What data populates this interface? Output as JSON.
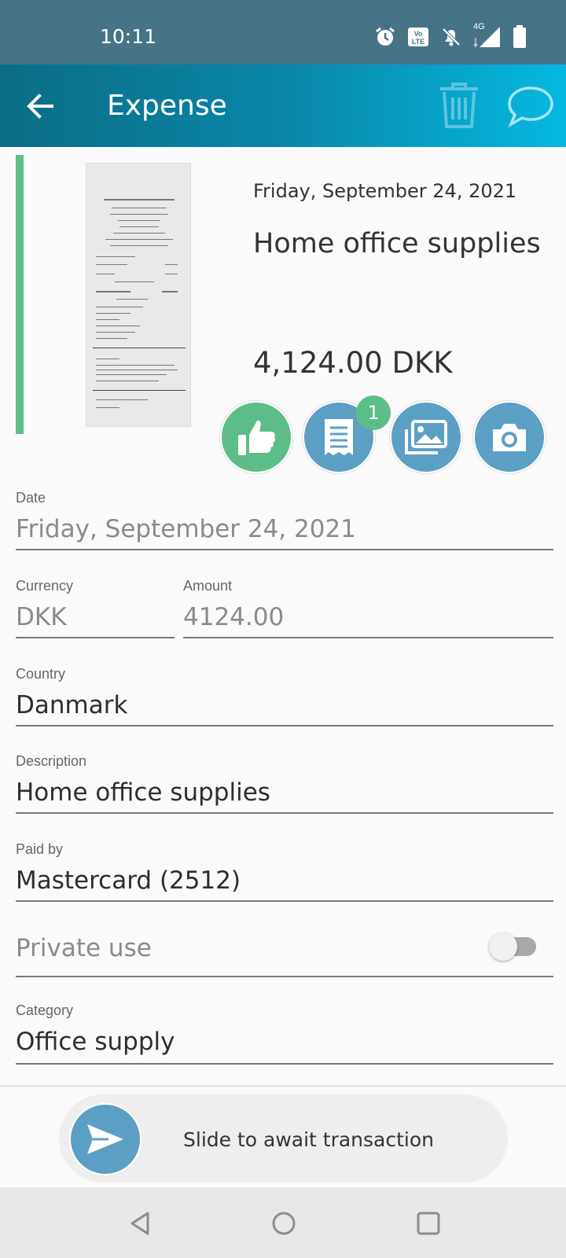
{
  "status_bar": {
    "time": "10:11",
    "network": "4G",
    "icons": [
      "alarm-icon",
      "volte-icon",
      "bell-off-icon",
      "signal-icon",
      "battery-icon"
    ]
  },
  "app_bar": {
    "title": "Expense",
    "icons": [
      "back-arrow-icon",
      "trash-icon",
      "chat-bubble-icon"
    ]
  },
  "summary": {
    "date": "Friday, September 24, 2021",
    "description": "Home office supplies",
    "amount": "4,124.00 DKK",
    "status_color": "#5fbf87",
    "receipt_badge": "1",
    "actions": [
      "thumbs-up-icon",
      "receipt-icon",
      "gallery-icon",
      "camera-icon"
    ]
  },
  "form": {
    "date": {
      "label": "Date",
      "value": "Friday, September 24, 2021"
    },
    "currency": {
      "label": "Currency",
      "value": "DKK"
    },
    "amount": {
      "label": "Amount",
      "value": "4124.00"
    },
    "country": {
      "label": "Country",
      "value": "Danmark"
    },
    "description": {
      "label": "Description",
      "value": "Home office supplies"
    },
    "paid_by": {
      "label": "Paid by",
      "value": "Mastercard (2512)"
    },
    "private_use": {
      "label": "Private use",
      "value": false
    },
    "category": {
      "label": "Category",
      "value": "Office supply"
    }
  },
  "slider": {
    "text": "Slide to await transaction"
  },
  "colors": {
    "status_bar": "#477386",
    "accent_blue": "#5c9fc4",
    "accent_green": "#5cbd88"
  }
}
